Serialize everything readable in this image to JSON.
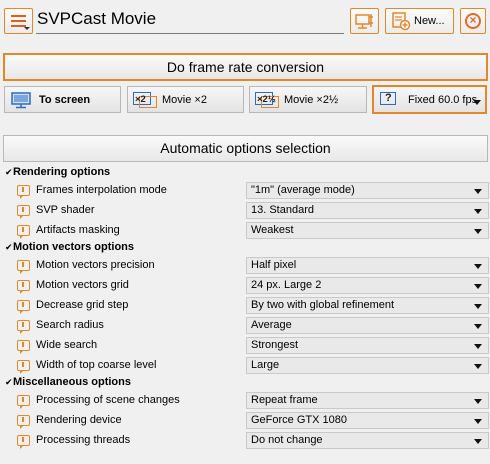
{
  "header": {
    "profile_name": "SVPCast Movie",
    "new_label": "New..."
  },
  "frame_rate_conversion_label": "Do frame rate conversion",
  "modes": {
    "to_screen": "To screen",
    "x2": "Movie ×2",
    "x25": "Movie ×2½",
    "fixed": "Fixed 60.0 fps",
    "x2_icon_text": "×2",
    "x25_icon_text": "×2½",
    "fixed_icon_text": "?"
  },
  "auto_options_label": "Automatic options selection",
  "sections": [
    {
      "title": "Rendering options",
      "rows": [
        {
          "label": "Frames interpolation mode",
          "value": "\"1m\" (average mode)"
        },
        {
          "label": "SVP shader",
          "value": "13. Standard"
        },
        {
          "label": "Artifacts masking",
          "value": "Weakest"
        }
      ]
    },
    {
      "title": "Motion vectors options",
      "rows": [
        {
          "label": "Motion vectors precision",
          "value": "Half pixel"
        },
        {
          "label": "Motion vectors grid",
          "value": "24 px. Large 2"
        },
        {
          "label": "Decrease grid step",
          "value": "By two with global refinement"
        },
        {
          "label": "Search radius",
          "value": "Average"
        },
        {
          "label": "Wide search",
          "value": "Strongest"
        },
        {
          "label": "Width of top coarse level",
          "value": "Large"
        }
      ]
    },
    {
      "title": "Miscellaneous options",
      "rows": [
        {
          "label": "Processing of scene changes",
          "value": "Repeat frame"
        },
        {
          "label": "Rendering device",
          "value": "GeForce GTX 1080"
        },
        {
          "label": "Processing threads",
          "value": "Do not change"
        }
      ]
    }
  ],
  "colors": {
    "accent": "#e0882c",
    "blue": "#2d6bc0"
  }
}
